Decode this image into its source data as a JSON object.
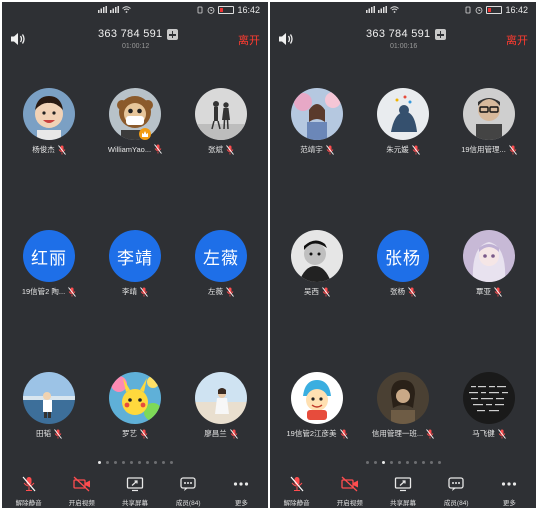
{
  "screens": [
    {
      "status": {
        "carrier": "HD 4G 4G",
        "time": "16:42"
      },
      "header": {
        "meeting_id": "363 784 591",
        "timer": "01:00:12",
        "leave_label": "离开"
      },
      "participants": [
        {
          "name": "杨俊杰",
          "avatar": "photo",
          "photo": "child-portrait"
        },
        {
          "name": "WilliamYao...",
          "avatar": "photo",
          "photo": "monkey-mask",
          "host": true
        },
        {
          "name": "张斌",
          "avatar": "photo",
          "photo": "couple-silhouette"
        },
        {
          "name": "红丽",
          "avatar": "text",
          "avatar_text": "红丽"
        },
        {
          "name": "李靖",
          "avatar": "text",
          "avatar_text": "李靖"
        },
        {
          "name": "左薇",
          "avatar": "text",
          "avatar_text": "左薇"
        },
        {
          "name": "田韬",
          "avatar": "photo",
          "photo": "seaside-person"
        },
        {
          "name": "罗艺",
          "avatar": "photo",
          "photo": "pikachu"
        },
        {
          "name": "廖昌兰",
          "avatar": "photo",
          "photo": "beach-girl"
        }
      ],
      "extra_name_3": "19信管2 陶...",
      "pager": {
        "count": 10,
        "active": 0
      }
    },
    {
      "status": {
        "carrier": "HD 4G 4G",
        "time": "16:42"
      },
      "header": {
        "meeting_id": "363 784 591",
        "timer": "01:00:16",
        "leave_label": "离开"
      },
      "participants": [
        {
          "name": "范靖宇",
          "avatar": "photo",
          "photo": "flowers-girl"
        },
        {
          "name": "朱元媛",
          "avatar": "photo",
          "photo": "sketch-figure"
        },
        {
          "name": "19信用管理...",
          "avatar": "photo",
          "photo": "glasses-man"
        },
        {
          "name": "吴西",
          "avatar": "photo",
          "photo": "bw-boy"
        },
        {
          "name": "张杨",
          "avatar": "text",
          "avatar_text": "张杨"
        },
        {
          "name": "覃亚",
          "avatar": "photo",
          "photo": "anime-girl"
        },
        {
          "name": "19信管2江彦美",
          "avatar": "photo",
          "photo": "cartoon-face"
        },
        {
          "name": "信用管理一班...",
          "avatar": "photo",
          "photo": "dim-portrait"
        },
        {
          "name": "马飞健",
          "avatar": "photo",
          "photo": "dark-text"
        }
      ],
      "pager": {
        "count": 10,
        "active": 2
      }
    }
  ],
  "toolbar": {
    "unmute_label": "解除静音",
    "video_label": "开启视频",
    "share_label": "共享屏幕",
    "members_label": "成员(84)",
    "more_label": "更多"
  },
  "colors": {
    "background": "#2e3034",
    "accent": "#1e6fe8",
    "leave": "#ff3b30",
    "muted_mic": "#ff4d4f"
  },
  "icons": [
    "speaker-icon",
    "add-meeting-icon",
    "mic-muted-icon",
    "video-off-icon",
    "share-screen-icon",
    "members-icon",
    "more-icon",
    "host-crown-icon"
  ]
}
